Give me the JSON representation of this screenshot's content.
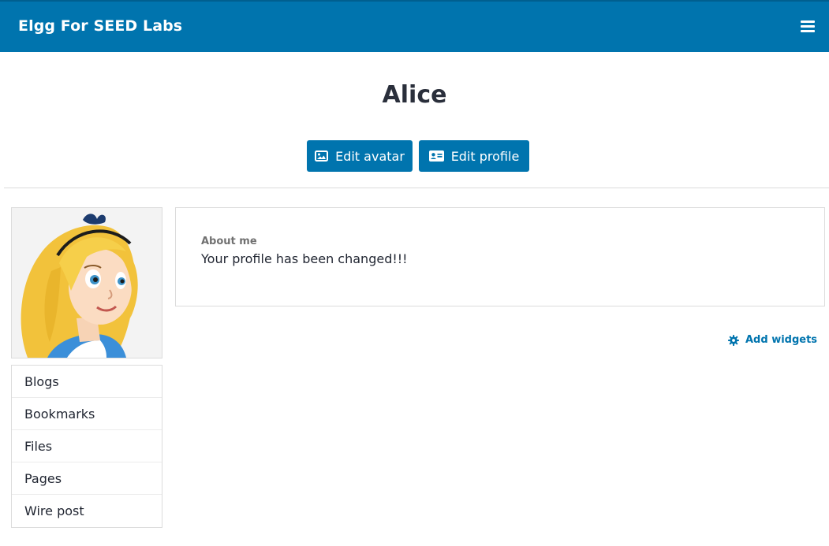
{
  "header": {
    "site_title": "Elgg For SEED Labs",
    "menu_icon": "hamburger-icon"
  },
  "profile": {
    "name": "Alice",
    "edit_avatar_label": "Edit avatar",
    "edit_avatar_icon": "image-icon",
    "edit_profile_label": "Edit profile",
    "edit_profile_icon": "id-card-icon"
  },
  "about": {
    "label": "About me",
    "value": "Your profile has been changed!!!"
  },
  "owner_menu": {
    "items": [
      {
        "label": "Blogs"
      },
      {
        "label": "Bookmarks"
      },
      {
        "label": "Files"
      },
      {
        "label": "Pages"
      },
      {
        "label": "Wire post"
      }
    ]
  },
  "widgets": {
    "add_label": "Add widgets",
    "add_icon": "gear-icon"
  },
  "colors": {
    "brand": "#0074ae",
    "text": "#1f2430",
    "border": "#dcdcdc"
  }
}
